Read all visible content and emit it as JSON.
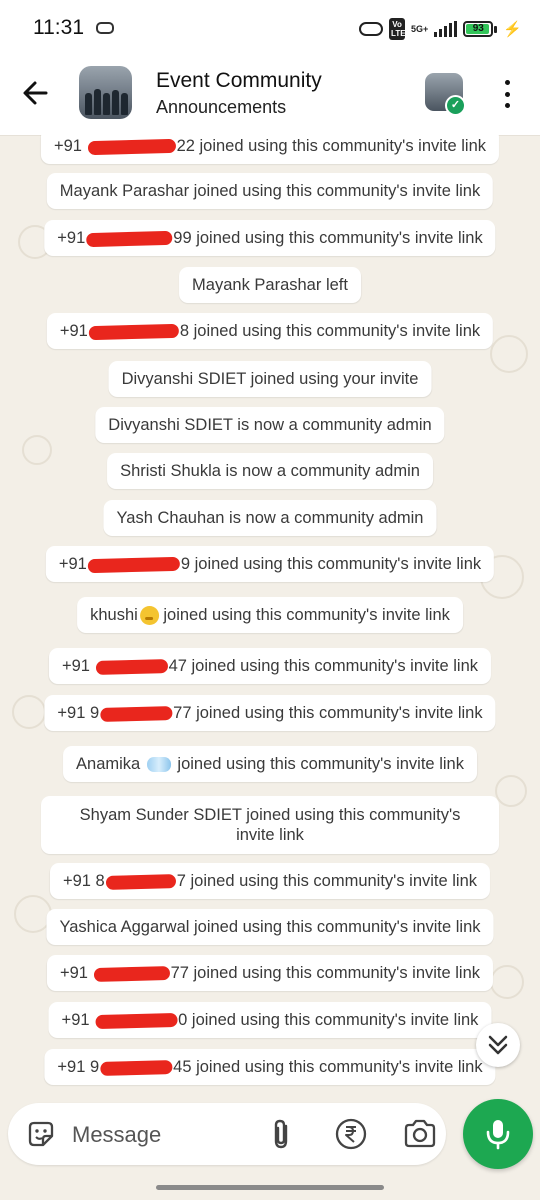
{
  "status_bar": {
    "time": "11:31",
    "battery": "93",
    "battery_level": 0.93,
    "network": "5G+",
    "volte": "Vo LTE",
    "bolt": "⚡"
  },
  "header": {
    "title": "Event Community",
    "subtitle": "Announcements"
  },
  "messages": [
    {
      "prefix": "+91",
      "suffix": "22 joined using this community's invite link"
    },
    {
      "text": "Mayank Parashar joined using this community's invite link"
    },
    {
      "prefix": "+91",
      "suffix": "99 joined using this community's invite link"
    },
    {
      "text": "Mayank Parashar left"
    },
    {
      "prefix": "+91",
      "suffix": "8 joined using this community's invite link"
    },
    {
      "text": "Divyanshi SDIET joined using your invite"
    },
    {
      "text": "Divyanshi SDIET is now a community admin"
    },
    {
      "text": "Shristi Shukla is now a community admin"
    },
    {
      "text": "Yash Chauhan is now a community admin"
    },
    {
      "prefix": "+91",
      "suffix": "9 joined using this community's invite link"
    },
    {
      "name": "khushi",
      "emoji": "blush-face",
      "suffix": " joined using this community's invite link"
    },
    {
      "prefix": "+91",
      "suffix": "47 joined using this community's invite link"
    },
    {
      "prefix": "+91 9",
      "suffix": "77 joined using this community's invite link"
    },
    {
      "name": "Anamika",
      "emoji": "nail-polish",
      "suffix": " joined using this community's invite link"
    },
    {
      "text": "Shyam Sunder SDIET joined using this community's invite link"
    },
    {
      "prefix": "+91 8",
      "suffix": "7 joined using this community's invite link"
    },
    {
      "text": "Yashica Aggarwal joined using this community's invite link"
    },
    {
      "prefix": "+91",
      "suffix": "77 joined using this community's invite link"
    },
    {
      "prefix": "+91",
      "suffix": "0 joined using this community's invite link"
    },
    {
      "prefix": "+91 9",
      "suffix": "45 joined using this community's invite link"
    }
  ],
  "composer": {
    "placeholder": "Message"
  },
  "icons": {
    "back": "arrow-left-icon",
    "menu": "more-vert-icon",
    "sticker": "sticker-icon",
    "attach": "paperclip-icon",
    "payment": "rupee-icon",
    "camera": "camera-icon",
    "mic": "mic-icon",
    "scroll": "double-chevron-down-icon"
  },
  "colors": {
    "accent": "#1da851",
    "redaction": "#e9261d",
    "chat_background": "#f3efe7"
  }
}
